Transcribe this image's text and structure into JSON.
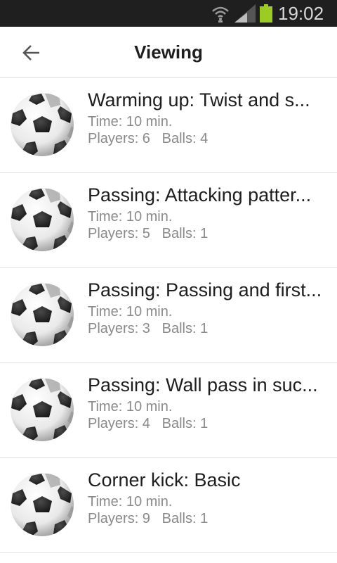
{
  "status_bar": {
    "time": "19:02",
    "icons": [
      "wifi-icon",
      "signal-icon",
      "battery-icon"
    ],
    "battery_color": "#9ccc22"
  },
  "app_bar": {
    "back_icon": "arrow-left-icon",
    "title": "Viewing"
  },
  "exercises": [
    {
      "title": "Warming up: Twist and s...",
      "time": "Time: 10 min.",
      "players": "Players: 6",
      "balls": "Balls: 4"
    },
    {
      "title": "Passing: Attacking patter...",
      "time": "Time: 10 min.",
      "players": "Players: 5",
      "balls": "Balls: 1"
    },
    {
      "title": "Passing: Passing and first...",
      "time": "Time: 10 min.",
      "players": "Players: 3",
      "balls": "Balls: 1"
    },
    {
      "title": "Passing: Wall pass in suc...",
      "time": "Time: 10 min.",
      "players": "Players: 4",
      "balls": "Balls: 1"
    },
    {
      "title": "Corner kick: Basic",
      "time": "Time: 10 min.",
      "players": "Players: 9",
      "balls": "Balls: 1"
    }
  ]
}
